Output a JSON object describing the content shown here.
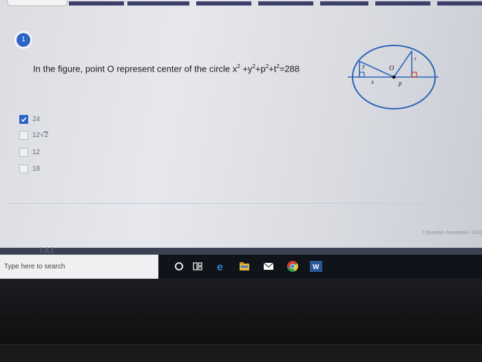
{
  "question": {
    "number": "1",
    "text_main": "In the figure,  point O represent center of the circle x",
    "exp1": "2",
    "plus_y": " +y",
    "exp2": "2",
    "plus_p": "+p",
    "exp3": "2",
    "plus_t": "+t",
    "exp4": "2",
    "equals": "=288"
  },
  "figure": {
    "label_y": "y",
    "label_o": "O",
    "label_t": "t",
    "label_x": "x",
    "label_p": "p"
  },
  "options": [
    {
      "label": "24",
      "checked": true
    },
    {
      "label_prefix": "12",
      "label_radical": "2",
      "checked": false
    },
    {
      "label": "12",
      "checked": false
    },
    {
      "label": "18",
      "checked": false
    }
  ],
  "footer": {
    "progress_text": "7 Question Answered / 10 Q",
    "partial_text": "IAI"
  },
  "taskbar": {
    "search_placeholder": "Type here to search",
    "icons": [
      "cortana-icon",
      "task-view-icon",
      "edge-icon",
      "file-explorer-icon",
      "mail-icon",
      "chrome-icon",
      "word-icon"
    ],
    "colors": {
      "edge": "#2f7fd6",
      "chrome_red": "#d93b30",
      "chrome_yellow": "#f2c230",
      "chrome_green": "#3a9c4a",
      "word": "#2b579a"
    }
  }
}
